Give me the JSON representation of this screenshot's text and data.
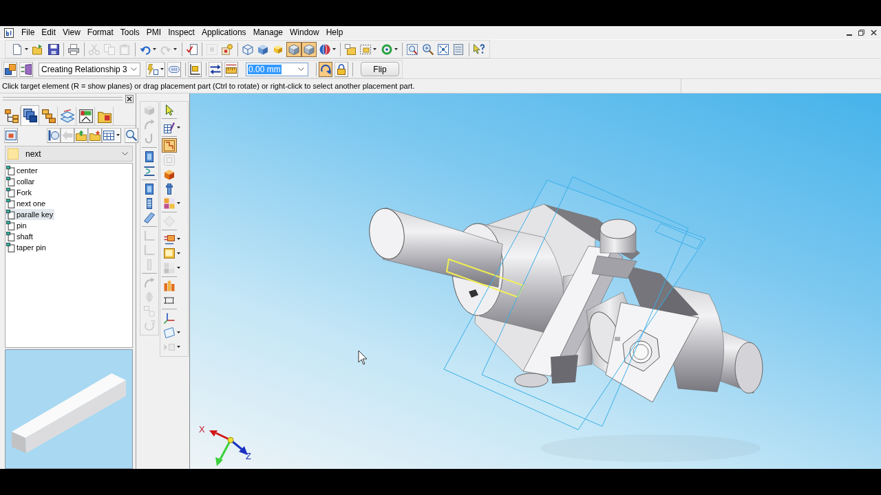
{
  "menu_bar": {
    "items": [
      "File",
      "Edit",
      "View",
      "Format",
      "Tools",
      "PMI",
      "Inspect",
      "Applications",
      "Manage",
      "Window",
      "Help"
    ]
  },
  "main_toolbar": {
    "buttons": [
      {
        "selected": false,
        "disabled": false
      },
      {
        "selected": false,
        "disabled": false
      },
      {
        "selected": false,
        "disabled": false
      },
      {
        "selected": false,
        "disabled": false
      },
      {
        "selected": false,
        "disabled": true
      },
      {
        "selected": false,
        "disabled": true
      },
      {
        "selected": false,
        "disabled": true
      },
      {
        "selected": false,
        "disabled": false
      },
      {
        "selected": false,
        "disabled": true
      },
      {
        "selected": false,
        "disabled": false
      },
      {
        "selected": false,
        "disabled": true
      },
      {
        "selected": false,
        "disabled": false
      },
      {
        "selected": false,
        "disabled": false
      },
      {
        "selected": false,
        "disabled": false
      },
      {
        "selected": false,
        "disabled": false
      },
      {
        "selected": true,
        "disabled": false
      },
      {
        "selected": true,
        "disabled": false
      },
      {
        "selected": false,
        "disabled": false
      },
      {
        "selected": false,
        "disabled": false
      },
      {
        "selected": false,
        "disabled": false
      },
      {
        "selected": false,
        "disabled": false
      },
      {
        "selected": false,
        "disabled": false
      },
      {
        "selected": false,
        "disabled": false
      },
      {
        "selected": false,
        "disabled": false
      },
      {
        "selected": false,
        "disabled": false
      },
      {
        "selected": false,
        "disabled": false
      }
    ]
  },
  "relationship_toolbar": {
    "items": [
      {
        "kind": "button",
        "selected": false
      },
      {
        "kind": "button",
        "selected": false
      },
      {
        "kind": "select",
        "value": "Creating Relationship 3"
      },
      {
        "kind": "button",
        "selected": false
      },
      {
        "kind": "button",
        "selected": false
      },
      {
        "kind": "button",
        "selected": false
      },
      {
        "kind": "button",
        "selected": false
      },
      {
        "kind": "button",
        "selected": false
      },
      {
        "kind": "field",
        "value": "0.00 mm",
        "text_selected": true
      },
      {
        "kind": "button",
        "selected": true
      },
      {
        "kind": "button",
        "selected": false
      },
      {
        "kind": "push_button",
        "label": "Flip"
      }
    ]
  },
  "prompt_bar": {
    "text": "Click target element (R = show planes) or drag placement part (Ctrl to rotate) or right-click to select another placement part."
  },
  "library_pane": {
    "tabs": [
      {
        "selected": false
      },
      {
        "selected": true
      },
      {
        "selected": false
      },
      {
        "selected": false
      },
      {
        "selected": false
      },
      {
        "selected": false
      }
    ],
    "toolbar": {
      "buttons": [
        {
          "disabled": false
        },
        {
          "disabled": false
        },
        {
          "disabled": true
        },
        {
          "disabled": false
        },
        {
          "disabled": false
        },
        {
          "disabled": false
        },
        {
          "disabled": false
        }
      ]
    },
    "folder": {
      "value": "next"
    },
    "files": [
      {
        "name": "center",
        "selected": false
      },
      {
        "name": "collar",
        "selected": false
      },
      {
        "name": "Fork",
        "selected": false
      },
      {
        "name": "next one",
        "selected": false
      },
      {
        "name": "paralle key",
        "selected": true
      },
      {
        "name": "pin",
        "selected": false
      },
      {
        "name": "shaft",
        "selected": false
      },
      {
        "name": "taper pin",
        "selected": false
      }
    ]
  },
  "feature_toolbars": {
    "left": {
      "buttons": [
        {
          "disabled": true
        },
        {
          "disabled": true
        },
        {
          "disabled": true
        },
        {
          "disabled": false
        },
        {
          "disabled": false
        },
        {
          "disabled": false
        },
        {
          "disabled": false
        },
        {
          "disabled": false
        },
        {
          "disabled": true
        },
        {
          "disabled": true
        },
        {
          "disabled": true
        },
        {
          "disabled": true
        },
        {
          "disabled": true
        },
        {
          "disabled": true
        },
        {
          "disabled": true
        }
      ]
    },
    "right": {
      "buttons": [
        {
          "selected": false,
          "disabled": false
        },
        {
          "selected": false,
          "disabled": false
        },
        {
          "selected": true,
          "disabled": false
        },
        {
          "selected": false,
          "disabled": true
        },
        {
          "selected": false,
          "disabled": false
        },
        {
          "selected": false,
          "disabled": false
        },
        {
          "selected": false,
          "disabled": false
        },
        {
          "selected": false,
          "disabled": true
        },
        {
          "selected": false,
          "disabled": false
        },
        {
          "selected": false,
          "disabled": false
        },
        {
          "selected": false,
          "disabled": true
        },
        {
          "selected": false,
          "disabled": false
        },
        {
          "selected": false,
          "disabled": false
        },
        {
          "selected": false,
          "disabled": false
        },
        {
          "selected": false,
          "disabled": false
        },
        {
          "selected": false,
          "disabled": true
        }
      ]
    }
  },
  "viewport": {
    "triad": {
      "x_label": "X",
      "z_label": "Z"
    }
  }
}
